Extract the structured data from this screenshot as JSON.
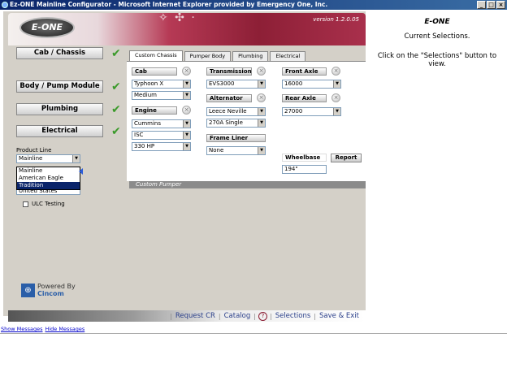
{
  "window": {
    "title": "Ez-ONE Mainline Configurator - Microsoft Internet Explorer provided by Emergency One, Inc.",
    "buttons": [
      "_",
      "□",
      "×"
    ]
  },
  "header": {
    "logo": "E-ONE",
    "version": "version 1.2.0.05"
  },
  "nav": {
    "items": [
      {
        "label": "Cab / Chassis"
      },
      {
        "label": "Body / Pump Module"
      },
      {
        "label": "Plumbing"
      },
      {
        "label": "Electrical"
      }
    ],
    "check": "✔"
  },
  "product_line": {
    "label": "Product Line",
    "value": "Mainline",
    "options": [
      "Mainline",
      "American Eagle",
      "Tradition"
    ],
    "selected_option": "Tradition",
    "behind_value": "United States"
  },
  "ulc": {
    "label": "ULC Testing"
  },
  "powered": {
    "line1": "Powered By",
    "line2": "Cincom"
  },
  "tabs": [
    {
      "label": "Custom Chassis"
    },
    {
      "label": "Pumper Body"
    },
    {
      "label": "Plumbing"
    },
    {
      "label": "Electrical"
    }
  ],
  "chassis": {
    "cab": {
      "label": "Cab",
      "values": [
        "Typhoon X",
        "Medium"
      ]
    },
    "engine": {
      "label": "Engine",
      "values": [
        "Cummins",
        "ISC",
        "330 HP"
      ]
    },
    "transmission": {
      "label": "Transmission",
      "value": "EVS3000"
    },
    "alternator": {
      "label": "Alternator",
      "values": [
        "Leece Neville",
        "270A Single"
      ]
    },
    "frame_liner": {
      "label": "Frame Liner",
      "value": "None"
    },
    "front_axle": {
      "label": "Front Axle",
      "value": "16000"
    },
    "rear_axle": {
      "label": "Rear Axle",
      "value": "27000"
    },
    "wheelbase": {
      "label": "Wheelbase",
      "value": "194\""
    },
    "report": "Report"
  },
  "custom_bar": "Custom Pumper",
  "footer": {
    "request": "Request CR",
    "catalog": "Catalog",
    "help": "?",
    "selections": "Selections",
    "save": "Save & Exit"
  },
  "right": {
    "logo": "E-ONE",
    "heading": "Current Selections.",
    "instruction": "Click on the \"Selections\" button to view."
  },
  "messages": {
    "show": "Show Messages",
    "hide": "Hide Messages"
  }
}
